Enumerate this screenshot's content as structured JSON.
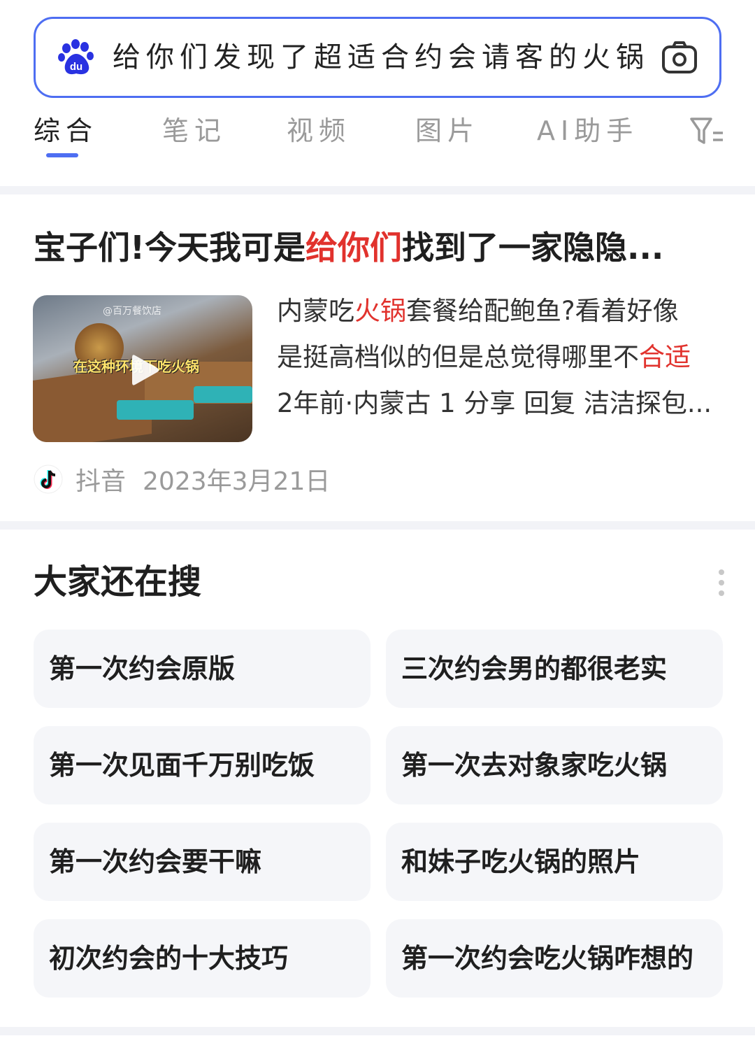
{
  "search": {
    "query": "给你们发现了超适合约会请客的火锅"
  },
  "tabs": [
    {
      "label": "综合",
      "active": true
    },
    {
      "label": "笔记"
    },
    {
      "label": "视频"
    },
    {
      "label": "图片"
    },
    {
      "label": "AI助手"
    }
  ],
  "result": {
    "title_before": "宝子们!今天我可是",
    "title_highlight": "给你们",
    "title_after": "找到了一家隐隐...",
    "thumbnail": {
      "caption": "在这种环境下吃火锅",
      "watermark": "@百万餐饮店"
    },
    "abstract": {
      "line1_a": "内蒙吃",
      "line1_hl": "火锅",
      "line1_b": "套餐给配鲍鱼?看着好像",
      "line2_a": "是挺高档似的但是总觉得哪里不",
      "line2_hl": "合适",
      "line3": "2年前·内蒙古 1 分享 回复 洁洁探包..."
    },
    "source": "抖音",
    "date": "2023年3月21日"
  },
  "related": {
    "title": "大家还在搜",
    "items": [
      "第一次约会原版",
      "三次约会男的都很老实",
      "第一次见面千万别吃饭",
      "第一次去对象家吃火锅",
      "第一次约会要干嘛",
      "和妹子吃火锅的照片",
      "初次约会的十大技巧",
      "第一次约会吃火锅咋想的"
    ]
  },
  "colors": {
    "accent": "#4e6ef2",
    "highlight": "#e1322d",
    "chip_bg": "#f5f6f9"
  },
  "icons": [
    "baidu-paw-icon",
    "camera-icon",
    "filter-icon",
    "play-icon",
    "douyin-icon",
    "more-vertical-icon"
  ]
}
